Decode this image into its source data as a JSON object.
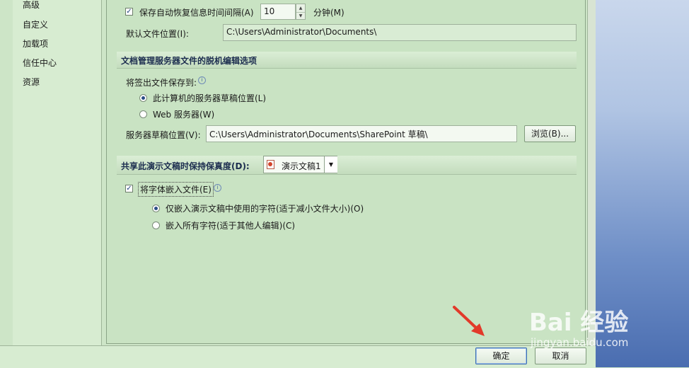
{
  "sidebar": {
    "items": [
      {
        "label": "高级"
      },
      {
        "label": "自定义"
      },
      {
        "label": "加载项"
      },
      {
        "label": "信任中心"
      },
      {
        "label": "资源"
      }
    ]
  },
  "autosave": {
    "label": "保存自动恢复信息时间间隔(A)",
    "checked": true,
    "minutes": "10",
    "unit_label": "分钟(M)"
  },
  "default_location": {
    "label": "默认文件位置(I):",
    "value": "C:\\Users\\Administrator\\Documents\\"
  },
  "offline_section": {
    "title": "文档管理服务器文件的脱机编辑选项",
    "save_to_label": "将签出文件保存到:",
    "option_local": "此计算机的服务器草稿位置(L)",
    "option_web": "Web 服务器(W)",
    "selected": "local",
    "drafts_label": "服务器草稿位置(V):",
    "drafts_value": "C:\\Users\\Administrator\\Documents\\SharePoint 草稿\\",
    "browse_label": "浏览(B)..."
  },
  "fidelity_section": {
    "title": "共享此演示文稿时保持保真度(D):",
    "presentation": "演示文稿1",
    "embed_fonts_label": "将字体嵌入文件(E)",
    "embed_fonts_checked": true,
    "option_used_only": "仅嵌入演示文稿中使用的字符(适于减小文件大小)(O)",
    "option_all": "嵌入所有字符(适于其他人编辑)(C)",
    "selected": "used_only"
  },
  "footer": {
    "ok_label": "确定",
    "cancel_label": "取消"
  },
  "icons": {
    "check": "✓",
    "info": "i",
    "spin_up": "▲",
    "spin_down": "▼",
    "dropdown": "▼"
  },
  "watermark": {
    "text": "Bai 经验",
    "url": "jingyan.baidu.com"
  }
}
